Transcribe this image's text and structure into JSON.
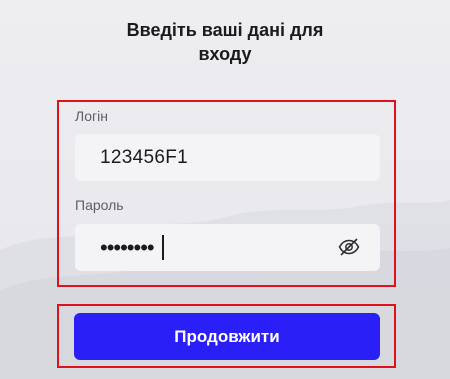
{
  "header": {
    "title_line1": "Введіть ваші дані для",
    "title_line2": "входу"
  },
  "login": {
    "label": "Логін",
    "value": "123456F1"
  },
  "password": {
    "label": "Пароль",
    "masked_value": "••••••••",
    "toggle_icon": "eye-slash-icon"
  },
  "actions": {
    "continue_label": "Продовжити"
  },
  "colors": {
    "primary": "#2b1ff7",
    "highlight": "#e0101d",
    "field_bg": "#f4f4f6"
  }
}
